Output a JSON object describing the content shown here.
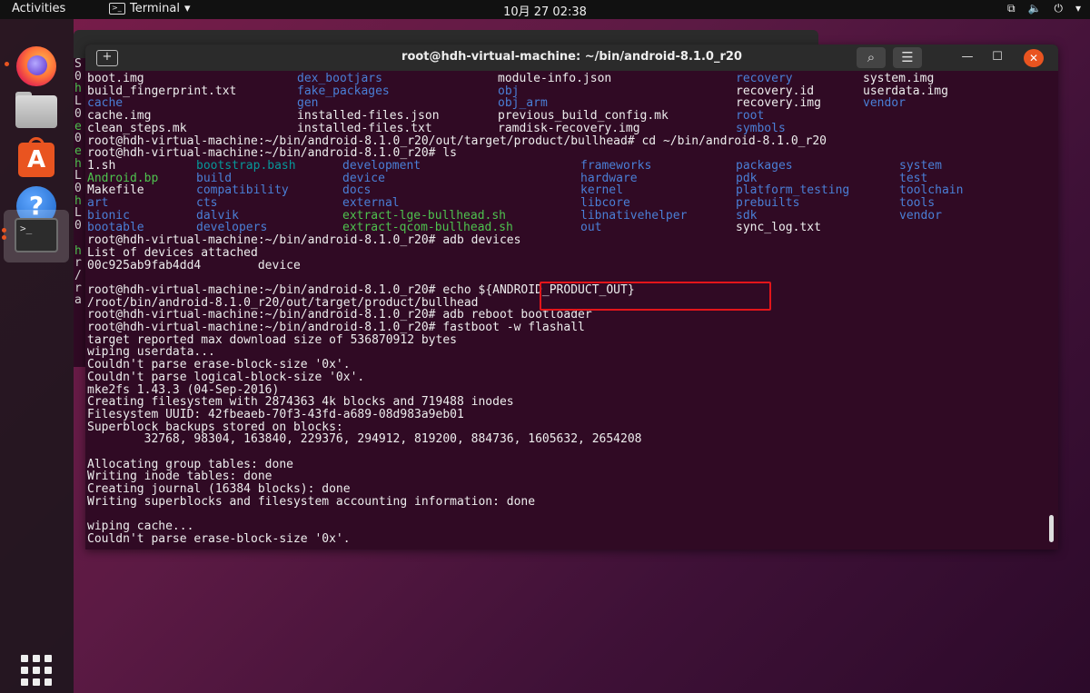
{
  "topbar": {
    "activities": "Activities",
    "app_menu": "Terminal",
    "clock": "10月 27  02:38"
  },
  "dock": {
    "items": [
      "firefox-icon",
      "files-icon",
      "ubuntu-software-icon",
      "help-icon",
      "terminal-icon",
      "show-applications-icon"
    ]
  },
  "window": {
    "title": "root@hdh-virtual-machine: ~/bin/android-8.1.0_r20"
  },
  "colors": {
    "terminal_bg": "#300a24",
    "directory": "#4a7fd6",
    "executable": "#4ec24e",
    "highlight": "#e3151a",
    "accent": "#e95420"
  },
  "bg_window_letters": [
    "S",
    "0",
    "h",
    "L",
    "0",
    "e",
    "0",
    "e",
    "h",
    "L",
    "0",
    "h",
    "L",
    "0",
    "",
    "h",
    "r",
    "/",
    "r",
    "a"
  ],
  "terminal": {
    "grid_rows": [
      [
        {
          "t": "boot.img"
        },
        {
          "t": "dex_bootjars",
          "c": "blue"
        },
        {
          "t": "module-info.json"
        },
        {
          "t": "recovery",
          "c": "blue"
        },
        {
          "t": "system.img"
        }
      ],
      [
        {
          "t": "build_fingerprint.txt"
        },
        {
          "t": "fake_packages",
          "c": "blue"
        },
        {
          "t": "obj",
          "c": "blue"
        },
        {
          "t": "recovery.id"
        },
        {
          "t": "userdata.img"
        }
      ],
      [
        {
          "t": "cache",
          "c": "blue"
        },
        {
          "t": "gen",
          "c": "blue"
        },
        {
          "t": "obj_arm",
          "c": "blue"
        },
        {
          "t": "recovery.img"
        },
        {
          "t": "vendor",
          "c": "blue"
        }
      ],
      [
        {
          "t": "cache.img"
        },
        {
          "t": "installed-files.json"
        },
        {
          "t": "previous_build_config.mk"
        },
        {
          "t": "root",
          "c": "blue"
        }
      ],
      [
        {
          "t": "clean_steps.mk"
        },
        {
          "t": "installed-files.txt"
        },
        {
          "t": "ramdisk-recovery.img"
        },
        {
          "t": "symbols",
          "c": "blue"
        }
      ]
    ],
    "cmd_cd": "root@hdh-virtual-machine:~/bin/android-8.1.0_r20/out/target/product/bullhead# cd ~/bin/android-8.1.0_r20",
    "cmd_ls": "root@hdh-virtual-machine:~/bin/android-8.1.0_r20# ls",
    "ls_rows": [
      [
        {
          "t": "1.sh"
        },
        {
          "t": "bootstrap.bash",
          "c": "cyan"
        },
        {
          "t": "development",
          "c": "blue"
        },
        {
          "t": "frameworks",
          "c": "blue"
        },
        {
          "t": "packages",
          "c": "blue"
        },
        {
          "t": "system",
          "c": "blue"
        }
      ],
      [
        {
          "t": "Android.bp",
          "c": "green"
        },
        {
          "t": "build",
          "c": "blue"
        },
        {
          "t": "device",
          "c": "blue"
        },
        {
          "t": "hardware",
          "c": "blue"
        },
        {
          "t": "pdk",
          "c": "blue"
        },
        {
          "t": "test",
          "c": "blue"
        }
      ],
      [
        {
          "t": "Makefile"
        },
        {
          "t": "compatibility",
          "c": "blue"
        },
        {
          "t": "docs",
          "c": "blue"
        },
        {
          "t": "kernel",
          "c": "blue"
        },
        {
          "t": "platform_testing",
          "c": "blue"
        },
        {
          "t": "toolchain",
          "c": "blue"
        }
      ],
      [
        {
          "t": "art",
          "c": "blue"
        },
        {
          "t": "cts",
          "c": "blue"
        },
        {
          "t": "external",
          "c": "blue"
        },
        {
          "t": "libcore",
          "c": "blue"
        },
        {
          "t": "prebuilts",
          "c": "blue"
        },
        {
          "t": "tools",
          "c": "blue"
        }
      ],
      [
        {
          "t": "bionic",
          "c": "blue"
        },
        {
          "t": "dalvik",
          "c": "blue"
        },
        {
          "t": "extract-lge-bullhead.sh",
          "c": "green"
        },
        {
          "t": "libnativehelper",
          "c": "blue"
        },
        {
          "t": "sdk",
          "c": "blue"
        },
        {
          "t": "vendor",
          "c": "blue"
        }
      ],
      [
        {
          "t": "bootable",
          "c": "blue"
        },
        {
          "t": "developers",
          "c": "blue"
        },
        {
          "t": "extract-qcom-bullhead.sh",
          "c": "green"
        },
        {
          "t": "out",
          "c": "blue"
        },
        {
          "t": "sync_log.txt"
        }
      ]
    ],
    "tail_lines": [
      "root@hdh-virtual-machine:~/bin/android-8.1.0_r20# adb devices",
      "List of devices attached",
      "00c925ab9fab4dd4        device",
      "",
      "root@hdh-virtual-machine:~/bin/android-8.1.0_r20# echo ${ANDROID_PRODUCT_OUT}",
      "/root/bin/android-8.1.0_r20/out/target/product/bullhead",
      "root@hdh-virtual-machine:~/bin/android-8.1.0_r20# adb reboot bootloader",
      "root@hdh-virtual-machine:~/bin/android-8.1.0_r20# fastboot -w flashall",
      "target reported max download size of 536870912 bytes",
      "wiping userdata...",
      "Couldn't parse erase-block-size '0x'.",
      "Couldn't parse logical-block-size '0x'.",
      "mke2fs 1.43.3 (04-Sep-2016)",
      "Creating filesystem with 2874363 4k blocks and 719488 inodes",
      "Filesystem UUID: 42fbeaeb-70f3-43fd-a689-08d983a9eb01",
      "Superblock backups stored on blocks:",
      "        32768, 98304, 163840, 229376, 294912, 819200, 884736, 1605632, 2654208",
      "",
      "Allocating group tables: done",
      "Writing inode tables: done",
      "Creating journal (16384 blocks): done",
      "Writing superblocks and filesystem accounting information: done",
      "",
      "wiping cache...",
      "Couldn't parse erase-block-size '0x'."
    ]
  }
}
